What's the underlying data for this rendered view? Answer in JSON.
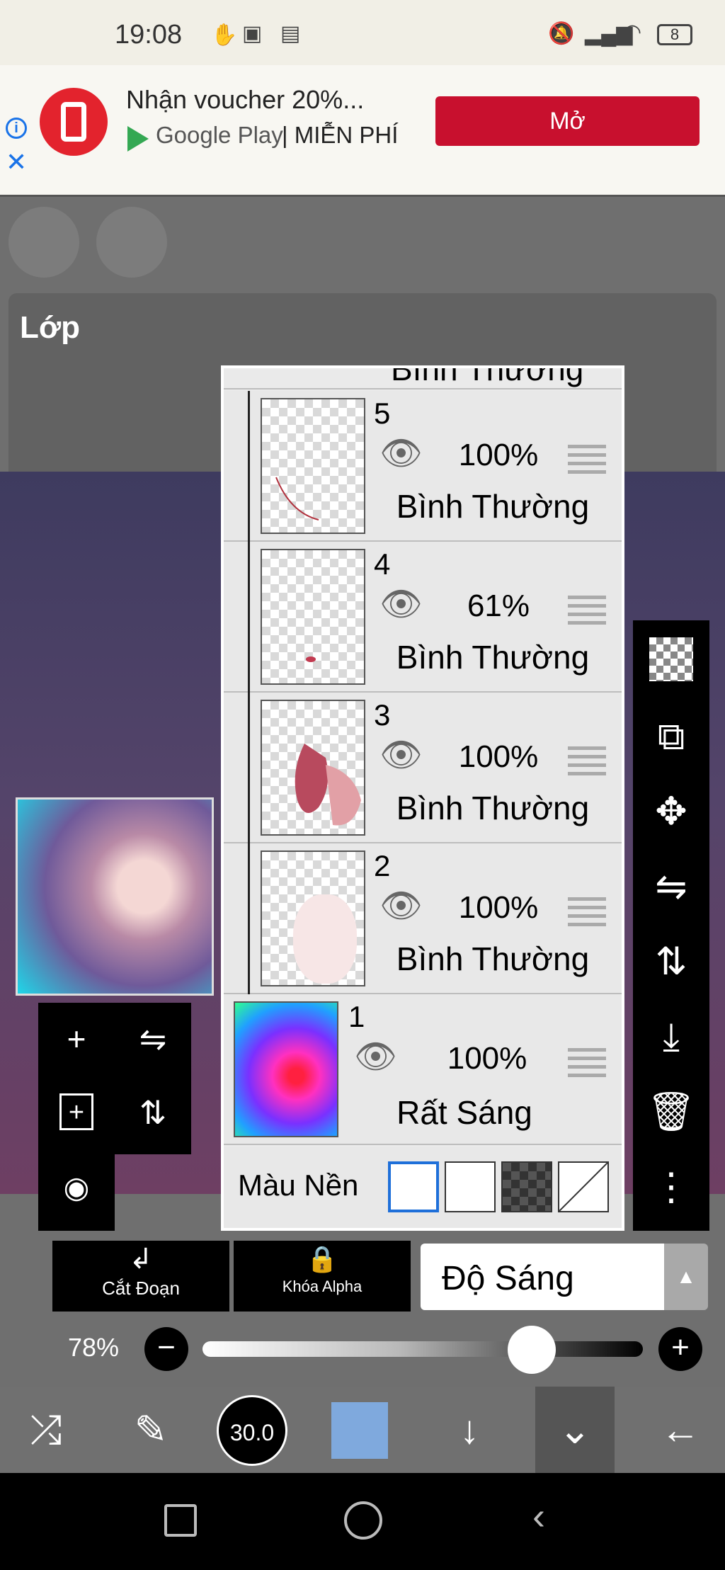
{
  "status_bar": {
    "time": "19:08",
    "battery": "8"
  },
  "ad": {
    "title": "Nhận voucher 20%...",
    "store": "Google Play",
    "price": "| MIỄN PHÍ",
    "cta": "Mở"
  },
  "panel": {
    "title": "Lớp"
  },
  "layers": {
    "top_partial_mode": "Bình Thường",
    "items": [
      {
        "number": "5",
        "opacity": "100%",
        "mode": "Bình Thường"
      },
      {
        "number": "4",
        "opacity": "61%",
        "mode": "Bình Thường"
      },
      {
        "number": "3",
        "opacity": "100%",
        "mode": "Bình Thường"
      },
      {
        "number": "2",
        "opacity": "100%",
        "mode": "Bình Thường"
      },
      {
        "number": "1",
        "opacity": "100%",
        "mode": "Rất Sáng"
      }
    ],
    "background_label": "Màu Nền"
  },
  "bottom": {
    "clip_label": "Cắt Đoạn",
    "alpha_label": "Khóa Alpha",
    "blend_mode": "Độ Sáng",
    "opacity_value": "78%",
    "opacity_level": 0.78,
    "brush_size": "30.0",
    "color": "#7fa9dd"
  }
}
